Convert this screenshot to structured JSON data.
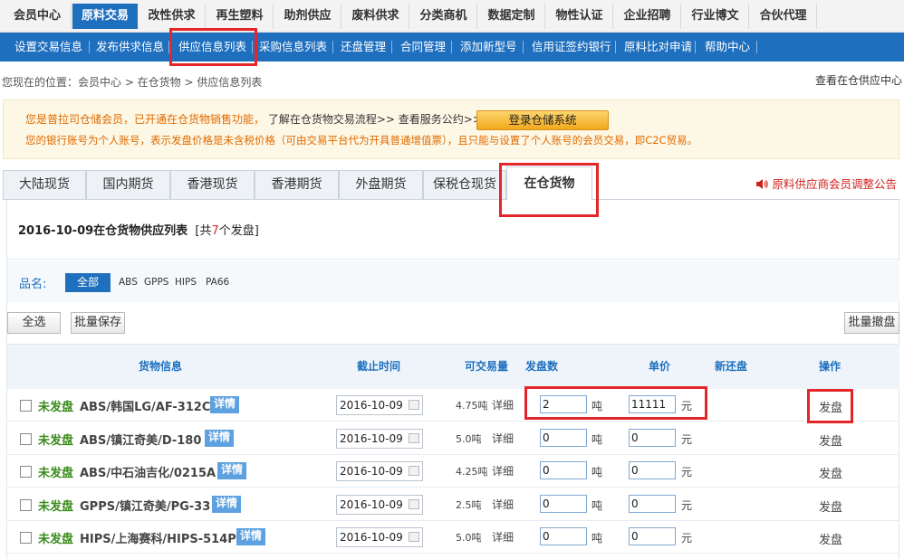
{
  "top_nav": [
    "会员中心",
    "原料交易",
    "改性供求",
    "再生塑料",
    "助剂供应",
    "废料供求",
    "分类商机",
    "数据定制",
    "物性认证",
    "企业招聘",
    "行业博文",
    "合伙代理"
  ],
  "top_nav_active": "原料交易",
  "sub_nav": [
    "设置交易信息",
    "发布供求信息",
    "供应信息列表",
    "采购信息列表",
    "还盘管理",
    "合同管理",
    "添加新型号",
    "信用证签约银行",
    "原料比对申请",
    "帮助中心"
  ],
  "sub_nav_active": "供应信息列表",
  "breadcrumb": "您现在的位置：会员中心 > 在仓货物 > 供应信息列表",
  "view_all": "查看在仓供应中心",
  "notice": {
    "line1_a": "您是普拉司仓储会员，已开通在仓货物销售功能，",
    "line1_b": "了解在仓货物交易流程>>",
    "line1_c": "查看服务公约>>",
    "login_button": "登录仓储系统",
    "line2": "您的银行账号为个人账号，表示发盘价格是未含税价格（可由交易平台代为开具普通增值票），且只能与设置了个人账号的会员交易，即C2C贸易。"
  },
  "tabs": [
    "大陆现货",
    "国内期货",
    "香港现货",
    "香港期货",
    "外盘期货",
    "保税仓现货",
    "在仓货物"
  ],
  "tab_active": "在仓货物",
  "announcement": "原料供应商会员调整公告",
  "list_title_date": "2016-10-09在仓货物供应列表",
  "list_title_count_pre": "[共",
  "list_title_count": "7",
  "list_title_count_post": "个发盘]",
  "filter": {
    "label": "品名:",
    "all": "全部",
    "options": [
      "ABS",
      "GPPS",
      "HIPS",
      "PA66"
    ]
  },
  "buttons": {
    "select_all": "全选",
    "batch_save": "批量保存",
    "batch_cancel": "批量撤盘"
  },
  "columns": {
    "goods": "货物信息",
    "deadline": "截止时间",
    "available": "可交易量",
    "offer_qty": "发盘数",
    "unit_price": "单价",
    "counter": "新还盘",
    "action": "操作"
  },
  "rows": [
    {
      "status": "未发盘",
      "goods": "ABS/韩国LG/AF-312C",
      "detail": "详情",
      "date": "2016-10-09",
      "qty": "4.75吨",
      "qty_detail": "详细",
      "offer": "2",
      "offer_unit": "吨",
      "price": "11111",
      "price_unit": "元",
      "action": "发盘"
    },
    {
      "status": "未发盘",
      "goods": "ABS/镇江奇美/D-180",
      "detail": "详情",
      "date": "2016-10-09",
      "qty": "5.0吨",
      "qty_detail": "详细",
      "offer": "0",
      "offer_unit": "吨",
      "price": "0",
      "price_unit": "元",
      "action": "发盘"
    },
    {
      "status": "未发盘",
      "goods": "ABS/中石油吉化/0215A",
      "detail": "详情",
      "date": "2016-10-09",
      "qty": "4.25吨",
      "qty_detail": "详细",
      "offer": "0",
      "offer_unit": "吨",
      "price": "0",
      "price_unit": "元",
      "action": "发盘"
    },
    {
      "status": "未发盘",
      "goods": "GPPS/镇江奇美/PG-33",
      "detail": "详情",
      "date": "2016-10-09",
      "qty": "2.5吨",
      "qty_detail": "详细",
      "offer": "0",
      "offer_unit": "吨",
      "price": "0",
      "price_unit": "元",
      "action": "发盘"
    },
    {
      "status": "未发盘",
      "goods": "HIPS/上海赛科/HIPS-514P",
      "detail": "详情",
      "date": "2016-10-09",
      "qty": "5.0吨",
      "qty_detail": "详细",
      "offer": "0",
      "offer_unit": "吨",
      "price": "0",
      "price_unit": "元",
      "action": "发盘"
    }
  ],
  "colors": {
    "primary_blue": "#1f6fbf",
    "highlight_red": "#e3262a",
    "status_green": "#3a8a1a",
    "notice_orange": "#e06a00"
  }
}
